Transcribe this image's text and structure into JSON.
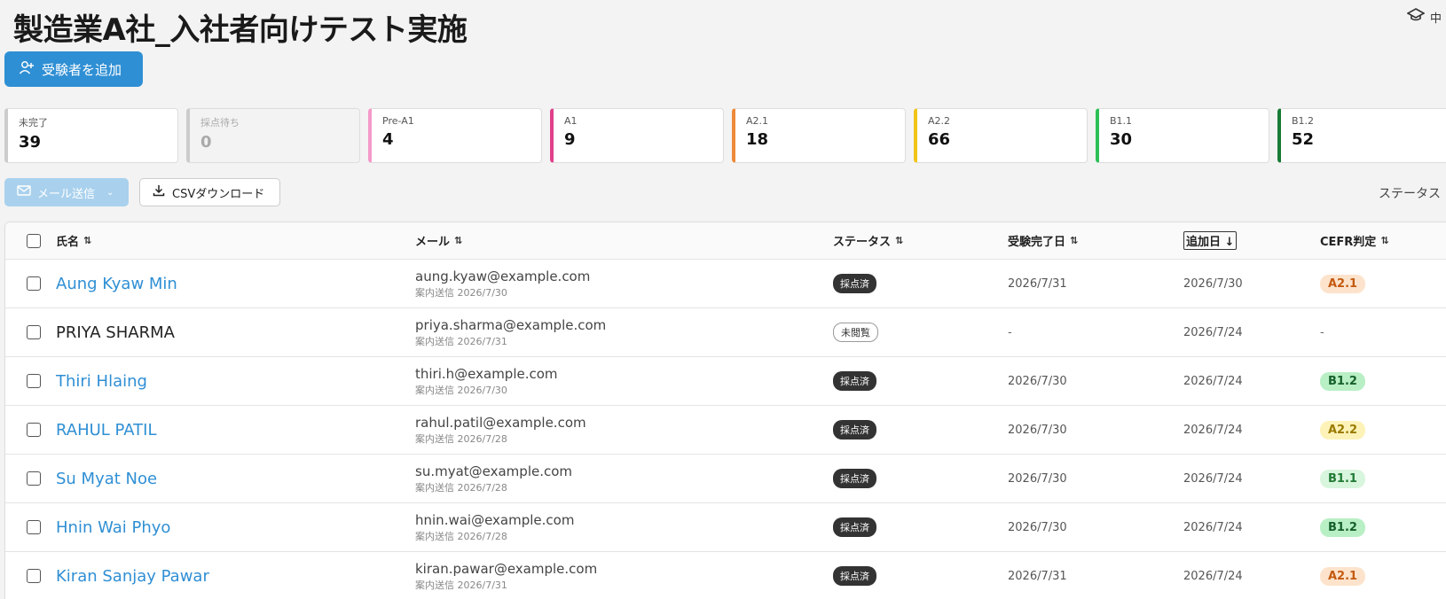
{
  "header": {
    "title": "製造業A社_入社者向けテスト実施",
    "top_right_label": "中"
  },
  "actions": {
    "add_examinee": "受験者を追加",
    "send_mail": "メール送信",
    "csv_download": "CSVダウンロード",
    "status_filter": "ステータス"
  },
  "stats": [
    {
      "label": "未完了",
      "value": "39",
      "color": "#cccccc",
      "disabled": false
    },
    {
      "label": "採点待ち",
      "value": "0",
      "color": "#cccccc",
      "disabled": true
    },
    {
      "label": "Pre-A1",
      "value": "4",
      "color": "#f49ac9",
      "disabled": false
    },
    {
      "label": "A1",
      "value": "9",
      "color": "#e0408a",
      "disabled": false
    },
    {
      "label": "A2.1",
      "value": "18",
      "color": "#ee8a3a",
      "disabled": false
    },
    {
      "label": "A2.2",
      "value": "66",
      "color": "#f2c418",
      "disabled": false
    },
    {
      "label": "B1.1",
      "value": "30",
      "color": "#2cc055",
      "disabled": false
    },
    {
      "label": "B1.2",
      "value": "52",
      "color": "#177a35",
      "disabled": false
    }
  ],
  "table": {
    "columns": {
      "name": "氏名",
      "mail": "メール",
      "status": "ステータス",
      "completed": "受験完了日",
      "added": "追加日",
      "cefr": "CEFR判定"
    },
    "rows": [
      {
        "name": "Aung Kyaw Min",
        "linked": true,
        "email": "aung.kyaw@example.com",
        "sent": "案内送信 2026/7/30",
        "status": "採点済",
        "status_style": "dark",
        "completed": "2026/7/31",
        "added": "2026/7/30",
        "cefr": "A2.1",
        "cefr_class": "cefr-a21"
      },
      {
        "name": "PRIYA SHARMA",
        "linked": false,
        "email": "priya.sharma@example.com",
        "sent": "案内送信 2026/7/31",
        "status": "未閲覧",
        "status_style": "outline",
        "completed": "-",
        "added": "2026/7/24",
        "cefr": "-",
        "cefr_class": ""
      },
      {
        "name": "Thiri Hlaing",
        "linked": true,
        "email": "thiri.h@example.com",
        "sent": "案内送信 2026/7/30",
        "status": "採点済",
        "status_style": "dark",
        "completed": "2026/7/30",
        "added": "2026/7/24",
        "cefr": "B1.2",
        "cefr_class": "cefr-b12"
      },
      {
        "name": "RAHUL PATIL",
        "linked": true,
        "email": "rahul.patil@example.com",
        "sent": "案内送信 2026/7/28",
        "status": "採点済",
        "status_style": "dark",
        "completed": "2026/7/30",
        "added": "2026/7/24",
        "cefr": "A2.2",
        "cefr_class": "cefr-a22"
      },
      {
        "name": "Su Myat Noe",
        "linked": true,
        "email": "su.myat@example.com",
        "sent": "案内送信 2026/7/28",
        "status": "採点済",
        "status_style": "dark",
        "completed": "2026/7/30",
        "added": "2026/7/24",
        "cefr": "B1.1",
        "cefr_class": "cefr-b11"
      },
      {
        "name": "Hnin Wai Phyo",
        "linked": true,
        "email": "hnin.wai@example.com",
        "sent": "案内送信 2026/7/28",
        "status": "採点済",
        "status_style": "dark",
        "completed": "2026/7/30",
        "added": "2026/7/24",
        "cefr": "B1.2",
        "cefr_class": "cefr-b12"
      },
      {
        "name": "Kiran Sanjay Pawar",
        "linked": true,
        "email": "kiran.pawar@example.com",
        "sent": "案内送信 2026/7/31",
        "status": "採点済",
        "status_style": "dark",
        "completed": "2026/7/31",
        "added": "2026/7/24",
        "cefr": "A2.1",
        "cefr_class": "cefr-a21"
      }
    ]
  }
}
